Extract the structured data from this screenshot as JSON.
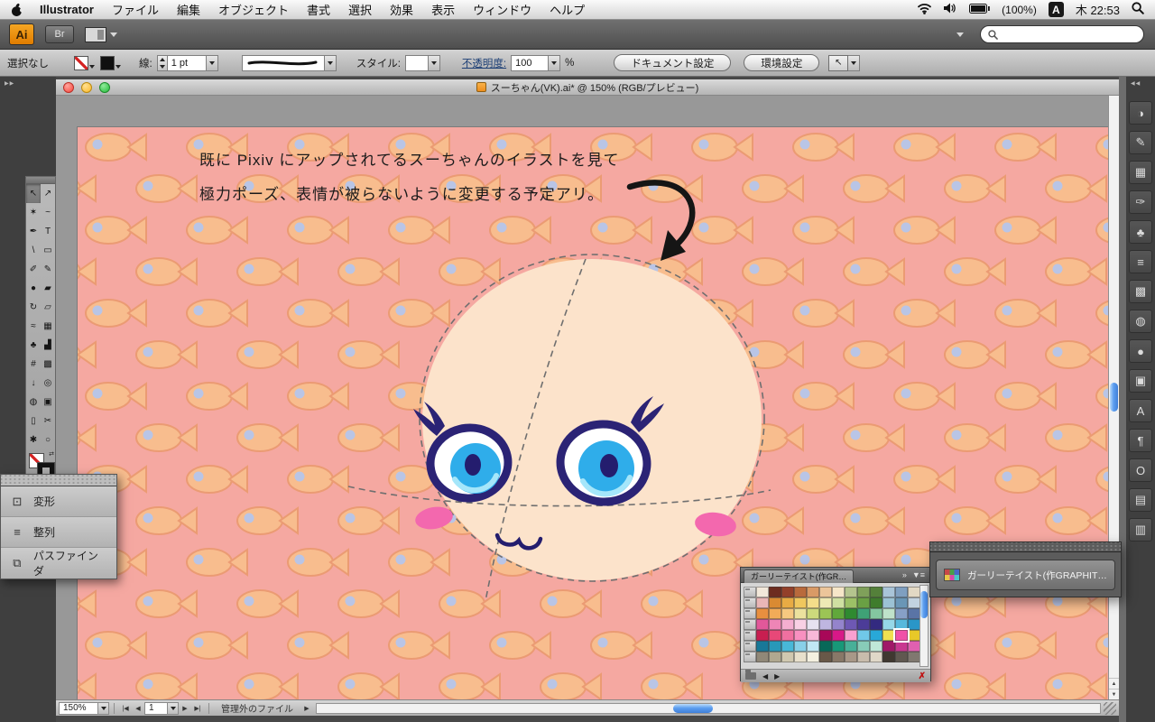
{
  "menubar": {
    "app_name": "Illustrator",
    "menus": [
      "ファイル",
      "編集",
      "オブジェクト",
      "書式",
      "選択",
      "効果",
      "表示",
      "ウィンドウ",
      "ヘルプ"
    ],
    "battery": "(100%)",
    "ime": "A",
    "clock": "木 22:53"
  },
  "appbar": {
    "ai_badge": "Ai",
    "br_badge": "Br"
  },
  "controlbar": {
    "selection_status": "選択なし",
    "stroke_label": "線:",
    "stroke_weight": "1 pt",
    "style_label": "スタイル:",
    "opacity_label": "不透明度:",
    "opacity_value": "100",
    "percent_sign": "%",
    "document_setup_button": "ドキュメント設定",
    "preferences_button": "環境設定",
    "cursor_glyph": "↖"
  },
  "window": {
    "title": "スーちゃん(VK).ai* @ 150% (RGB/プレビュー)",
    "zoom_value": "150%",
    "page_value": "1",
    "status_text": "管理外のファイル"
  },
  "canvas": {
    "annotation_line1": "既に Pixiv にアップされてるスーちゃんのイラストを見て",
    "annotation_line2": "極力ポーズ、表情が被らないように変更する予定アリ。"
  },
  "icons": {
    "collapse_left": "▶▶",
    "collapse_right": "◀◀",
    "tab_overflow": "»",
    "panel_menu": "▼≡",
    "nav_first": "|◀",
    "nav_prev": "◀",
    "nav_next": "▶",
    "nav_last": "▶|",
    "go_arrow": "▶",
    "swatch_prev": "◀",
    "swatch_next": "▶",
    "no_edit": "✗",
    "scroll_up": "▲",
    "scroll_down": "▼",
    "swap": "⇄"
  },
  "toolbox": {
    "tools": [
      {
        "name": "selection-tool",
        "glyph": "↖"
      },
      {
        "name": "direct-selection-tool",
        "glyph": "↗"
      },
      {
        "name": "magic-wand-tool",
        "glyph": "✶"
      },
      {
        "name": "lasso-tool",
        "glyph": "~"
      },
      {
        "name": "pen-tool",
        "glyph": "✒"
      },
      {
        "name": "type-tool",
        "glyph": "T"
      },
      {
        "name": "line-segment-tool",
        "glyph": "\\"
      },
      {
        "name": "rectangle-tool",
        "glyph": "▭"
      },
      {
        "name": "paintbrush-tool",
        "glyph": "✐"
      },
      {
        "name": "pencil-tool",
        "glyph": "✎"
      },
      {
        "name": "blob-brush-tool",
        "glyph": "●"
      },
      {
        "name": "eraser-tool",
        "glyph": "▰"
      },
      {
        "name": "rotate-tool",
        "glyph": "↻"
      },
      {
        "name": "scale-tool",
        "glyph": "▱"
      },
      {
        "name": "warp-tool",
        "glyph": "≈"
      },
      {
        "name": "free-transform-tool",
        "glyph": "▦"
      },
      {
        "name": "symbol-sprayer-tool",
        "glyph": "♣"
      },
      {
        "name": "column-graph-tool",
        "glyph": "▟"
      },
      {
        "name": "mesh-tool",
        "glyph": "#"
      },
      {
        "name": "gradient-tool",
        "glyph": "▩"
      },
      {
        "name": "eyedropper-tool",
        "glyph": "↓"
      },
      {
        "name": "blend-tool",
        "glyph": "◎"
      },
      {
        "name": "live-paint-bucket-tool",
        "glyph": "◍"
      },
      {
        "name": "live-paint-selection-tool",
        "glyph": "▣"
      },
      {
        "name": "artboard-tool",
        "glyph": "▯"
      },
      {
        "name": "slice-tool",
        "glyph": "✂"
      },
      {
        "name": "hand-tool",
        "glyph": "✱"
      },
      {
        "name": "zoom-tool",
        "glyph": "○"
      }
    ]
  },
  "left_panel": {
    "items": [
      {
        "name": "transform",
        "label": "変形",
        "glyph": "⊡"
      },
      {
        "name": "align",
        "label": "整列",
        "glyph": "≡"
      },
      {
        "name": "pathfinder",
        "label": "パスファインダ",
        "glyph": "⧉"
      }
    ]
  },
  "right_dock": {
    "icons": [
      {
        "name": "color-icon",
        "glyph": "◑"
      },
      {
        "name": "color-guide-icon",
        "glyph": "✎"
      },
      {
        "name": "swatches-icon",
        "glyph": "▦"
      },
      {
        "name": "brushes-icon",
        "glyph": "✑"
      },
      {
        "name": "symbols-icon",
        "glyph": "♣"
      },
      {
        "name": "stroke-icon",
        "glyph": "≡"
      },
      {
        "name": "gradient-icon",
        "glyph": "▩"
      },
      {
        "name": "transparency-icon",
        "glyph": "◍"
      },
      {
        "name": "appearance-icon",
        "glyph": "●"
      },
      {
        "name": "graphic-styles-icon",
        "glyph": "▣"
      },
      {
        "name": "character-icon",
        "glyph": "A"
      },
      {
        "name": "paragraph-icon",
        "glyph": "¶"
      },
      {
        "name": "opentype-icon",
        "glyph": "O"
      },
      {
        "name": "layers-icon",
        "glyph": "▤"
      },
      {
        "name": "artboards-icon",
        "glyph": "▥"
      }
    ]
  },
  "swatches_panel": {
    "tab_title": "ガーリーテイスト(作GR…",
    "selected": {
      "row": 4,
      "col": 11
    },
    "rows": [
      [
        "#f2e8da",
        "#6d2c20",
        "#93402a",
        "#b96a3c",
        "#d99a66",
        "#ecc59a",
        "#f6e6c8",
        "#b4c48e",
        "#7fa05a",
        "#54803a",
        "#a9c4d8",
        "#7f9fc0",
        "#e2d8c4"
      ],
      [
        "#e9b6b6",
        "#d98a32",
        "#e8ab44",
        "#f0c75e",
        "#f4dd8a",
        "#eee9b4",
        "#cfe0a2",
        "#9cc066",
        "#6aa044",
        "#3f7c2c",
        "#9cc2d4",
        "#6a96b6",
        "#c2d2e0"
      ],
      [
        "#e88f3f",
        "#f2ab58",
        "#f6c880",
        "#ece29e",
        "#cdda7c",
        "#9cc455",
        "#61a83b",
        "#2f8a30",
        "#3fa276",
        "#84c6a0",
        "#bfe2ca",
        "#87a0c6",
        "#5a74a6"
      ],
      [
        "#e2589a",
        "#ee85b6",
        "#f4aed0",
        "#f8d0e4",
        "#e6e2f0",
        "#beb6e0",
        "#9484cc",
        "#6e58b4",
        "#4c3c98",
        "#332a80",
        "#96d8e8",
        "#57b8dc",
        "#2a96c8"
      ],
      [
        "#c81e50",
        "#e84878",
        "#f070a0",
        "#f890c0",
        "#f8b8d8",
        "#a80858",
        "#d81888",
        "#f8a0d0",
        "#70c8e8",
        "#28a8d8",
        "#f0e050",
        "#f050a8",
        "#e8c828"
      ],
      [
        "#187898",
        "#2898b8",
        "#48b8d8",
        "#88d0e8",
        "#c0e8f4",
        "#086858",
        "#189878",
        "#48b098",
        "#88ccb8",
        "#c0e8d8",
        "#a01868",
        "#c83890",
        "#e060b0"
      ],
      [
        "#908878",
        "#b0a890",
        "#d0c8b0",
        "#e8e0cc",
        "#f4f0e0",
        "#685848",
        "#887868",
        "#a89888",
        "#c8bcac",
        "#e0d8c8",
        "#403830",
        "#605850",
        "#807870"
      ]
    ]
  },
  "collapsed_panel": {
    "label": "ガーリーテイスト(作GRAPHIT…"
  },
  "artwork": {
    "pattern_bg": "#f5a8a1",
    "fish_body": "#f8bd8e",
    "fish_outline": "#eb9b73",
    "fish_eye": "#b9c5e6",
    "face_fill": "#fce3cb",
    "eye_outline": "#2b2375",
    "iris": "#2fadea",
    "pupil": "#241d6e",
    "iris_highlight": "#a5e6fa",
    "cheek": "#f368ae",
    "guide_dash": "#6f6f6f",
    "arrow": "#151515"
  }
}
